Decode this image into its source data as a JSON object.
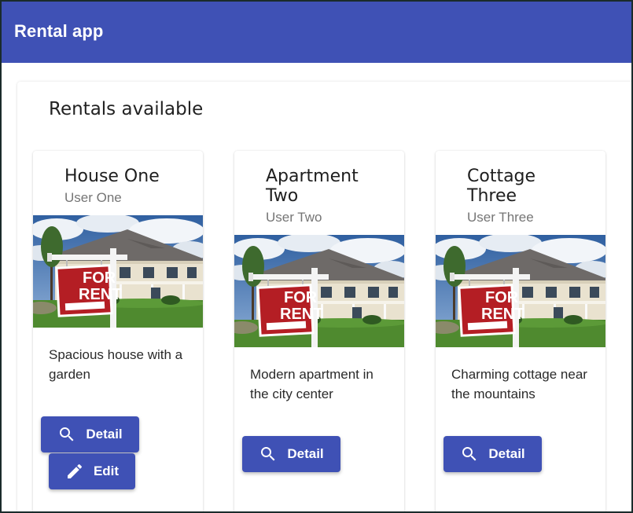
{
  "app": {
    "title": "Rental app"
  },
  "section": {
    "title": "Rentals available"
  },
  "sign": {
    "line1": "FOR",
    "line2": "RENT"
  },
  "rentals": [
    {
      "name": "House One",
      "owner": "User One",
      "description": "Spacious house with a garden",
      "detail_label": "Detail",
      "edit_label": "Edit"
    },
    {
      "name": "Apartment Two",
      "owner": "User Two",
      "description": "Modern apartment in the city center",
      "detail_label": "Detail"
    },
    {
      "name": "Cottage Three",
      "owner": "User Three",
      "description": "Charming cottage near the mountains",
      "detail_label": "Detail"
    }
  ],
  "icons": {
    "detail": "search-icon",
    "edit": "pencil-icon"
  },
  "colors": {
    "primary": "#3f51b5",
    "on_primary": "#ffffff"
  }
}
